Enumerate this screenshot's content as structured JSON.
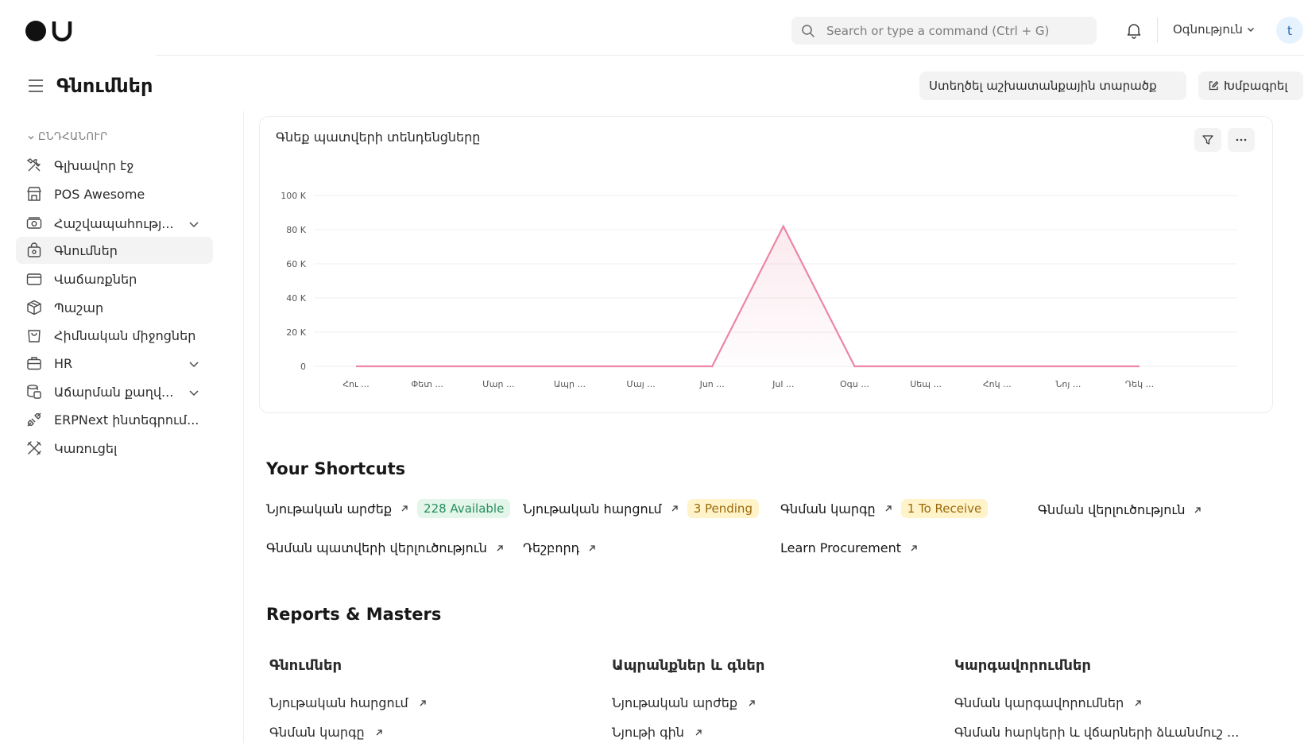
{
  "navbar": {
    "search_placeholder": "Search or type a command (Ctrl + G)",
    "help_label": "Օգնություն",
    "avatar_initial": "t"
  },
  "page": {
    "title": "Գնումներ",
    "create_workspace_label": "Ստեղծել աշխատանքային տարածք",
    "edit_label": "Խմբագրել"
  },
  "sidebar": {
    "section_label": "ԸՆԴՀԱՆՈՒՐ",
    "items": [
      {
        "label": "Գլխավոր էջ",
        "icon": "tools-icon"
      },
      {
        "label": "POS Awesome",
        "icon": "store-icon"
      },
      {
        "label": "Հաշվապահությ...",
        "icon": "money-icon",
        "expandable": true
      },
      {
        "label": "Գնումներ",
        "icon": "shopping-bag-icon",
        "active": true
      },
      {
        "label": "Վաճառքներ",
        "icon": "card-icon"
      },
      {
        "label": "Պաշար",
        "icon": "box-icon"
      },
      {
        "label": "Հիմնական միջոցներ",
        "icon": "bag-icon"
      },
      {
        "label": "HR",
        "icon": "briefcase-icon",
        "expandable": true
      },
      {
        "label": "Աճարման քաղվ...",
        "icon": "database-icon",
        "expandable": true
      },
      {
        "label": "ERPNext ինտեգրում...",
        "icon": "plug-icon"
      },
      {
        "label": "Կառուցել",
        "icon": "build-tools-icon"
      }
    ]
  },
  "chart_card": {
    "title": "Գնեք պատվերի տենդենցները"
  },
  "chart_data": {
    "type": "line",
    "title": "Գնեք պատվերի տենդենցները",
    "categories": [
      "Հու ...",
      "Փետ ...",
      "Մար ...",
      "Ապր ...",
      "Մայ ...",
      "Jun ...",
      "Jul ...",
      "Օգս ...",
      "Սեպ ...",
      "Հոկ ...",
      "Նոյ ...",
      "Դեկ ..."
    ],
    "series": [
      {
        "values": [
          0,
          0,
          0,
          0,
          0,
          0,
          82000,
          0,
          0,
          0,
          0,
          0
        ]
      }
    ],
    "y_ticks": [
      "0",
      "20 K",
      "40 K",
      "60 K",
      "80 K",
      "100 K"
    ],
    "ylim": [
      0,
      100000
    ],
    "line_color": "#ec86a4",
    "grid": true
  },
  "shortcuts": {
    "heading": "Your Shortcuts",
    "items": [
      {
        "label": "Նյութական արժեք",
        "badge": "228 Available",
        "badge_color": "green"
      },
      {
        "label": "Նյութական հարցում",
        "badge": "3 Pending",
        "badge_color": "yellow"
      },
      {
        "label": "Գնման կարգը",
        "badge": "1 To Receive",
        "badge_color": "yellow"
      },
      {
        "label": "Գնման վերլուծություն"
      },
      {
        "label": "Գնման պատվերի վերլուծություն"
      },
      {
        "label": "Դեշբորդ"
      },
      {
        "label": "Learn Procurement"
      }
    ]
  },
  "reports": {
    "heading": "Reports & Masters",
    "columns": [
      {
        "title": "Գնումներ",
        "links": [
          "Նյութական հարցում",
          "Գնման կարգը"
        ]
      },
      {
        "title": "Ապրանքներ և գներ",
        "links": [
          "Նյութական արժեք",
          "Նյութի գին"
        ]
      },
      {
        "title": "Կարգավորումներ",
        "links": [
          "Գնման կարգավորումներ",
          "Գնման հարկերի և վճարների ձևանմուշ ..."
        ]
      }
    ]
  }
}
